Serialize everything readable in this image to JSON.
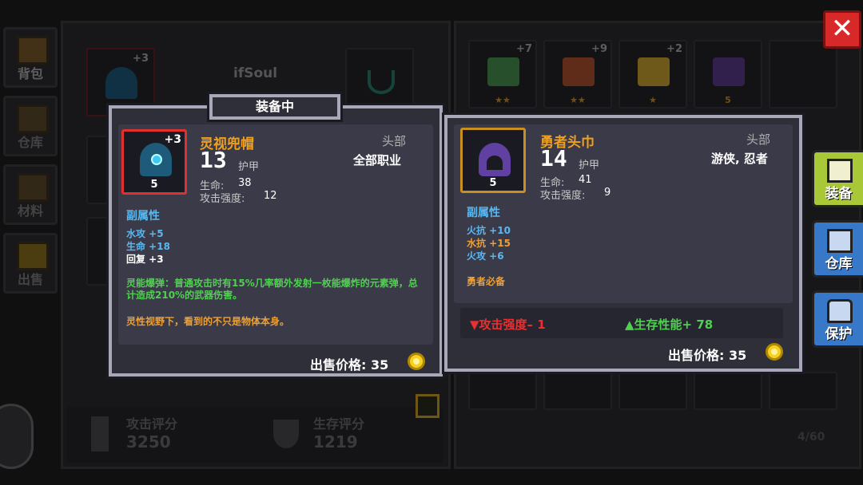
{
  "nav": {
    "backpack": "背包",
    "warehouse": "仓库",
    "materials": "材料",
    "sell": "出售"
  },
  "right_tabs": {
    "equip": "装备",
    "warehouse": "仓库",
    "protect": "保护"
  },
  "background": {
    "player_name": "ifSoul",
    "equipped_helmet_plus": "+3",
    "attack_score_label": "攻击评分",
    "attack_score_value": "3250",
    "survival_score_label": "生存评分",
    "survival_score_value": "1219",
    "inventory_count": "4/60",
    "inventory_top_row": [
      {
        "plus": "+7",
        "stars": "★★",
        "color": "#4a9050"
      },
      {
        "plus": "+9",
        "stars": "★★",
        "color": "#b05030"
      },
      {
        "plus": "+2",
        "stars": "★",
        "color": "#c8a030"
      },
      {
        "plus": "",
        "stars": "5",
        "color": "#5a3a8a"
      }
    ]
  },
  "equipped_card": {
    "banner": "装备中",
    "name": "灵视兜帽",
    "plus": "+3",
    "level": "5",
    "armor_value": "13",
    "armor_label": "护甲",
    "slot": "头部",
    "class": "全部职业",
    "life_label": "生命:",
    "life_value": "38",
    "attack_label": "攻击强度:",
    "attack_value": "12",
    "sub_header": "副属性",
    "subs": [
      {
        "text": "水攻 +5",
        "color": "#5ab8f0"
      },
      {
        "text": "生命 +18",
        "color": "#5ab8f0"
      },
      {
        "text": "回复 +3",
        "color": "#ffffff"
      }
    ],
    "effect": "灵能爆弹：普通攻击时有15%几率额外发射一枚能爆炸的元素弹，总计造成210%的武器伤害。",
    "flavor": "灵性视野下，看到的不只是物体本身。",
    "price_label": "出售价格: 35",
    "accent": "#e03030"
  },
  "compare_card": {
    "name": "勇者头巾",
    "level": "5",
    "armor_value": "14",
    "armor_label": "护甲",
    "slot": "头部",
    "class": "游侠, 忍者",
    "life_label": "生命:",
    "life_value": "41",
    "attack_label": "攻击强度:",
    "attack_value": "9",
    "sub_header": "副属性",
    "subs": [
      {
        "text": "火抗 +10",
        "color": "#5ab8f0"
      },
      {
        "text": "水抗 +15",
        "color": "#f0a030"
      },
      {
        "text": "火攻 +6",
        "color": "#5ab8f0"
      }
    ],
    "set_note": "勇者必备",
    "diff_down": "▼攻击强度– 1",
    "diff_up": "▲生存性能+ 78",
    "price_label": "出售价格: 35",
    "accent": "#c89020"
  },
  "close_label": "✕"
}
